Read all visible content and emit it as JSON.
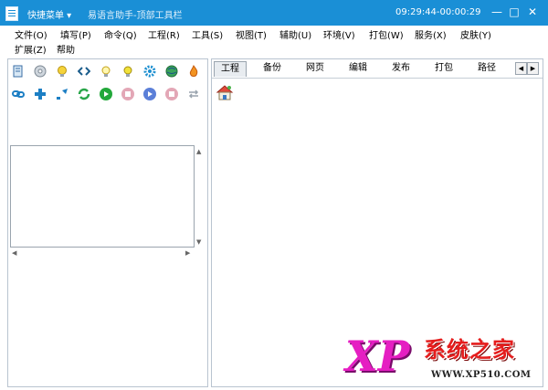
{
  "titlebar": {
    "quick_menu": "快捷菜单 ▾",
    "title": "易语言助手-顶部工具栏",
    "clock": "09:29:44-00:00:29",
    "minimize": "—",
    "maximize": "□",
    "close": "✕"
  },
  "menu": [
    "文件(O)",
    "填写(P)",
    "命令(Q)",
    "工程(R)",
    "工具(S)",
    "视图(T)",
    "辅助(U)",
    "环境(V)",
    "打包(W)",
    "服务(X)",
    "皮肤(Y)",
    "扩展(Z)",
    "帮助"
  ],
  "toolbar": {
    "row1": [
      "book-icon",
      "disc-icon",
      "bulb-icon",
      "code-icon",
      "bulb-icon",
      "bulb-icon",
      "gear-icon",
      "globe-icon",
      "flame-icon"
    ],
    "row2": [
      "link-icon",
      "add-icon",
      "arrow-icon",
      "refresh-icon",
      "play-icon",
      "stop-icon",
      "next-icon",
      "stop-icon",
      "exchange-icon"
    ]
  },
  "tabs": [
    "工程",
    "备份",
    "网页",
    "编辑",
    "发布",
    "打包",
    "路径"
  ],
  "tab_nav": {
    "prev": "◀",
    "next": "▶"
  },
  "scroll": {
    "up": "▲",
    "down": "▼",
    "left": "◀",
    "right": "▶"
  },
  "watermark": {
    "logo": "XP",
    "name": "系统之家",
    "url": "WWW.XP510.COM"
  },
  "colors": {
    "titlebar": "#1a8fd6",
    "watermark_magenta": "#e51ec2",
    "watermark_red": "#e51d1d"
  }
}
